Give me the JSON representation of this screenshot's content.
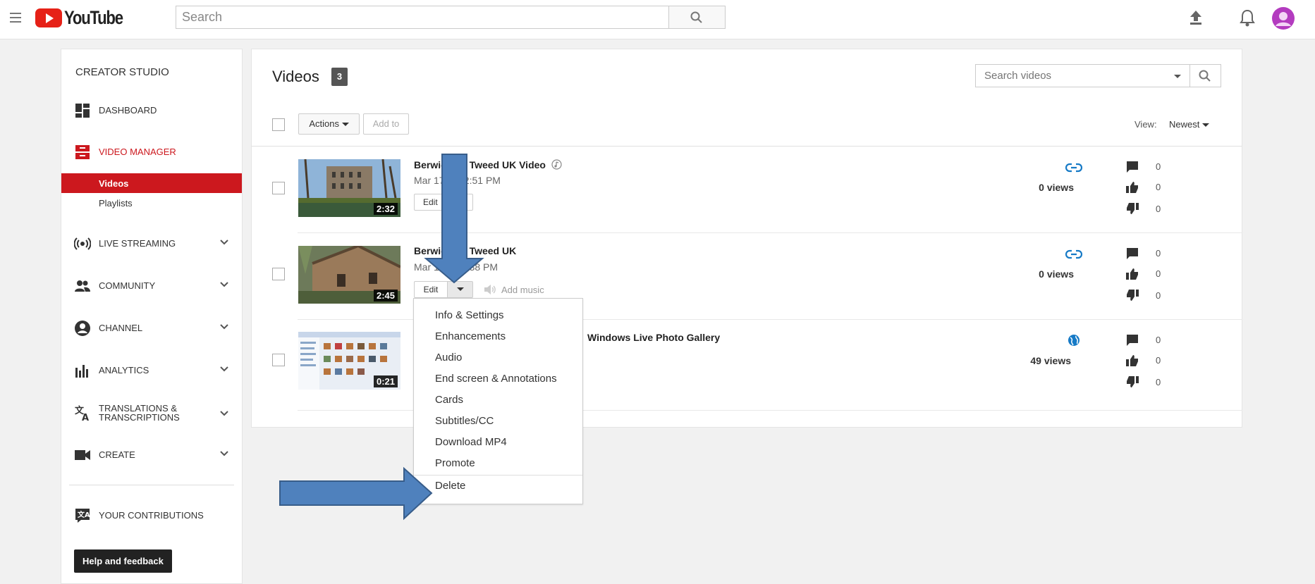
{
  "header": {
    "logo_text": "YouTube",
    "search_placeholder": "Search"
  },
  "sidebar": {
    "title": "CREATOR STUDIO",
    "dashboard": "DASHBOARD",
    "video_manager": "VIDEO MANAGER",
    "videos": "Videos",
    "playlists": "Playlists",
    "live_streaming": "LIVE STREAMING",
    "community": "COMMUNITY",
    "channel": "CHANNEL",
    "analytics": "ANALYTICS",
    "translations_line1": "TRANSLATIONS &",
    "translations_line2": "TRANSCRIPTIONS",
    "create": "CREATE",
    "your_contributions": "YOUR CONTRIBUTIONS",
    "help_feedback": "Help and feedback"
  },
  "main": {
    "title": "Videos",
    "count": "3",
    "search_placeholder": "Search videos",
    "actions_label": "Actions",
    "add_to_label": "Add to",
    "view_label": "View:",
    "sort_value": "Newest",
    "colors": {
      "accent": "#cc181e",
      "link": "#167ac6",
      "arrow": "#4f81bd"
    }
  },
  "videos": [
    {
      "title": "Berwic   on Tweed UK Video",
      "date": "Mar 17    3 2:51 PM",
      "duration": "2:32",
      "views": "0 views",
      "comments": "0",
      "likes": "0",
      "dislikes": "0",
      "edit": "Edit",
      "privacy_icon": "link-icon"
    },
    {
      "title": "Berwic   on Tweed UK",
      "date": "Mar 1        6:38 PM",
      "duration": "2:45",
      "views": "0 views",
      "comments": "0",
      "likes": "0",
      "dislikes": "0",
      "edit": "Edit",
      "add_music": "Add music",
      "privacy_icon": "link-icon"
    },
    {
      "title": "Windows Live Photo Gallery",
      "duration": "0:21",
      "views": "49 views",
      "comments": "0",
      "likes": "0",
      "dislikes": "0",
      "privacy_icon": "globe-icon"
    }
  ],
  "menu": {
    "items": [
      "Info & Settings",
      "Enhancements",
      "Audio",
      "End screen & Annotations",
      "Cards",
      "Subtitles/CC",
      "Download MP4",
      "Promote"
    ],
    "delete": "Delete"
  }
}
